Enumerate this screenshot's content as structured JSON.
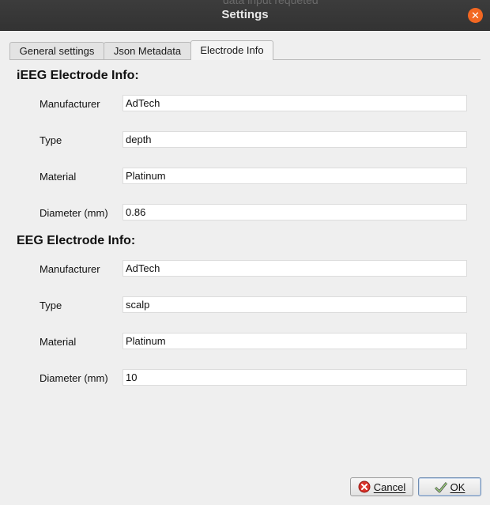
{
  "window": {
    "title": "Settings",
    "ghost_text": "data input requeted"
  },
  "tabs": [
    {
      "label": "General settings",
      "active": false
    },
    {
      "label": "Json Metadata",
      "active": false
    },
    {
      "label": "Electrode Info",
      "active": true
    }
  ],
  "ieeg": {
    "title": "iEEG Electrode Info:",
    "manufacturer_label": "Manufacturer",
    "manufacturer_value": "AdTech",
    "type_label": "Type",
    "type_value": "depth",
    "material_label": "Material",
    "material_value": "Platinum",
    "diameter_label": "Diameter (mm)",
    "diameter_value": "0.86"
  },
  "eeg": {
    "title": "EEG Electrode Info:",
    "manufacturer_label": "Manufacturer",
    "manufacturer_value": "AdTech",
    "type_label": "Type",
    "type_value": "scalp",
    "material_label": "Material",
    "material_value": "Platinum",
    "diameter_label": "Diameter (mm)",
    "diameter_value": "10"
  },
  "buttons": {
    "cancel_label": "Cancel",
    "ok_label": "OK"
  },
  "icons": {
    "close": "close-icon",
    "cancel": "cancel-icon",
    "ok": "ok-checkmark-icon"
  },
  "colors": {
    "titlebar": "#333333",
    "close_button": "#f26722",
    "dialog_background": "#efefef"
  }
}
